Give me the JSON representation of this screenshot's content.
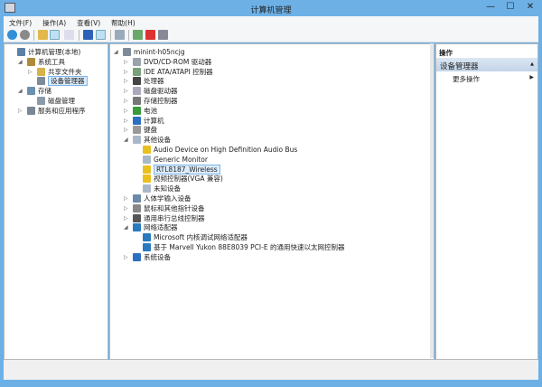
{
  "window": {
    "title": "计算机管理",
    "controls": [
      "—",
      "☐",
      "✕"
    ]
  },
  "menu": [
    "文件(F)",
    "操作(A)",
    "查看(V)",
    "帮助(H)"
  ],
  "left_tree": [
    {
      "label": "计算机管理(本地)",
      "level": 0,
      "expander": "",
      "color": "#5b7fa6"
    },
    {
      "label": "系统工具",
      "level": 1,
      "expander": "◢",
      "color": "#b08a3a"
    },
    {
      "label": "共享文件夹",
      "level": 2,
      "expander": "▷",
      "color": "#d6b24a"
    },
    {
      "label": "设备管理器",
      "level": 2,
      "expander": "",
      "color": "#7d8b99",
      "selected": true
    },
    {
      "label": "存储",
      "level": 1,
      "expander": "◢",
      "color": "#6c8fb0"
    },
    {
      "label": "磁盘管理",
      "level": 2,
      "expander": "",
      "color": "#8a9aa8"
    },
    {
      "label": "服务和应用程序",
      "level": 1,
      "expander": "▷",
      "color": "#7a8796"
    }
  ],
  "device_tree": [
    {
      "label": "minint-h05ncjg",
      "level": 0,
      "expander": "◢",
      "color": "#7d8b99"
    },
    {
      "label": "DVD/CD-ROM 驱动器",
      "level": 1,
      "expander": "▷",
      "color": "#9aa3ab"
    },
    {
      "label": "IDE ATA/ATAPI 控制器",
      "level": 1,
      "expander": "▷",
      "color": "#7aa07a"
    },
    {
      "label": "处理器",
      "level": 1,
      "expander": "▷",
      "color": "#444"
    },
    {
      "label": "磁盘驱动器",
      "level": 1,
      "expander": "▷",
      "color": "#aab"
    },
    {
      "label": "存储控制器",
      "level": 1,
      "expander": "▷",
      "color": "#777"
    },
    {
      "label": "电池",
      "level": 1,
      "expander": "▷",
      "color": "#3a9a3a"
    },
    {
      "label": "计算机",
      "level": 1,
      "expander": "▷",
      "color": "#2d6fc0"
    },
    {
      "label": "键盘",
      "level": 1,
      "expander": "▷",
      "color": "#999"
    },
    {
      "label": "其他设备",
      "level": 1,
      "expander": "◢",
      "color": "#a9b8c8"
    },
    {
      "label": "Audio Device on High Definition Audio Bus",
      "level": 2,
      "expander": "",
      "color": "#e8c020"
    },
    {
      "label": "Generic Monitor",
      "level": 2,
      "expander": "",
      "color": "#a9b8c8"
    },
    {
      "label": "RTL8187_Wireless",
      "level": 2,
      "expander": "",
      "color": "#e8c020",
      "selected": true
    },
    {
      "label": "视频控制器(VGA 兼容)",
      "level": 2,
      "expander": "",
      "color": "#e8c020"
    },
    {
      "label": "未知设备",
      "level": 2,
      "expander": "",
      "color": "#a9b8c8"
    },
    {
      "label": "人体学输入设备",
      "level": 1,
      "expander": "▷",
      "color": "#6a8aa8"
    },
    {
      "label": "鼠标和其他指针设备",
      "level": 1,
      "expander": "▷",
      "color": "#888"
    },
    {
      "label": "通用串行总线控制器",
      "level": 1,
      "expander": "▷",
      "color": "#555"
    },
    {
      "label": "网络适配器",
      "level": 1,
      "expander": "◢",
      "color": "#2a7ac0"
    },
    {
      "label": "Microsoft 内核调试网络适配器",
      "level": 2,
      "expander": "",
      "color": "#2a7ac0"
    },
    {
      "label": "基于 Marvell Yukon 88E8039 PCI-E 的通用快速以太网控制器",
      "level": 2,
      "expander": "",
      "color": "#2a7ac0"
    },
    {
      "label": "系统设备",
      "level": 1,
      "expander": "▷",
      "color": "#2d6fc0"
    }
  ],
  "actions": {
    "header": "操作",
    "section": "设备管理器",
    "collapse": "▲",
    "items": [
      {
        "label": "更多操作",
        "arrow": "▶"
      }
    ]
  }
}
